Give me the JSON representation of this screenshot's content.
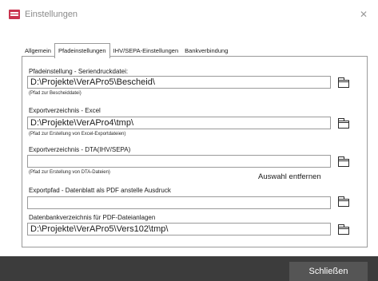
{
  "window": {
    "title": "Einstellungen",
    "close_glyph": "✕"
  },
  "tabs": [
    {
      "label": "Allgemein"
    },
    {
      "label": "Pfadeinstellungen",
      "active": true
    },
    {
      "label": "IHV/SEPA-Einstellungen"
    },
    {
      "label": "Bankverbindung"
    }
  ],
  "fields": [
    {
      "label": "Pfadeinstellung - Seriendruckdatei:",
      "value": "D:\\Projekte\\VerAPro5\\Bescheid\\",
      "hint": "(Pfad zur Bescheiddatei)",
      "browse_icon": "folder-icon"
    },
    {
      "label": "Exportverzeichnis - Excel",
      "value": "D:\\Projekte\\VerAPro4\\tmp\\",
      "hint": "(Pfad zur Erstellung von Excel-Exportdateien)",
      "browse_icon": "folder-icon"
    },
    {
      "label": "Exportverzeichnis - DTA(IHV/SEPA)",
      "value": "",
      "hint": "(Pfad zur Erstellung von DTA-Dateien)",
      "browse_icon": "folder-icon"
    },
    {
      "label": "Exportpfad - Datenblatt als PDF anstelle Ausdruck",
      "value": "",
      "browse_icon": "folder-icon"
    },
    {
      "label": "Datenbankverzeichnis für PDF-Dateianlagen",
      "value": "D:\\Projekte\\VerAPro5\\Vers102\\tmp\\",
      "browse_icon": "folder-icon"
    }
  ],
  "remove_selection": "Auswahl entfernen",
  "footer": {
    "close_label": "Schließen"
  },
  "colors": {
    "app_icon": "#c9344f",
    "footer_bg": "#3c3c3c",
    "footer_button": "#555555"
  }
}
